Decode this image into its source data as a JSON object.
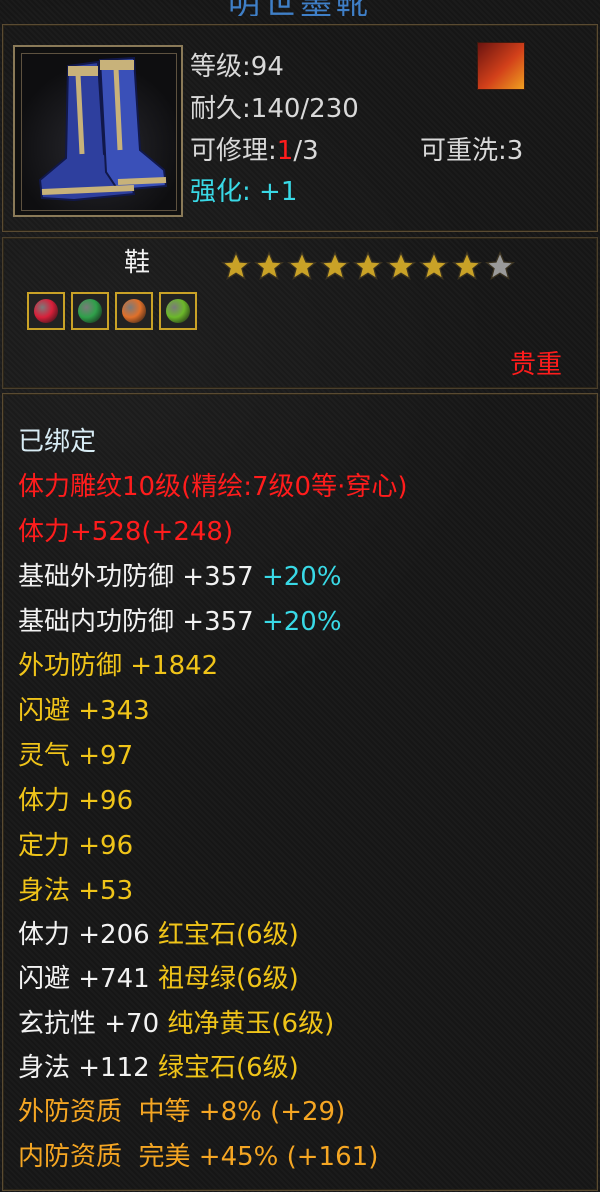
{
  "header": {
    "title": "明世墨靴"
  },
  "item": {
    "level_label": "等级",
    "level_value": ":94",
    "durability_label": "耐久",
    "durability_value": ":140/230",
    "repair_label": "可修理:",
    "repair_used": "1",
    "repair_total": "/3",
    "rewash": "可重洗:3",
    "enhance_label": "强化:",
    "enhance_value": "+1"
  },
  "slot": {
    "type": "鞋",
    "stars_filled": 8,
    "stars_total": 9,
    "rarity": "贵重"
  },
  "gems": [
    {
      "color": "#d8203a"
    },
    {
      "color": "#2fa04a"
    },
    {
      "color": "#e0702a"
    },
    {
      "color": "#6cb82a"
    }
  ],
  "colors": {
    "icon_border": "#8a7a58",
    "gem_border": "#c9a227",
    "star_gold": "#c9a227",
    "star_grey": "#9a9a9a"
  },
  "stats": {
    "bound": "已绑定",
    "engrave": "体力雕纹10级(精绘:7级0等·穿心)",
    "stamina_total": "体力+528(+248)",
    "base_outer_def_label": "基础外功防御",
    "base_outer_def_value": "+357",
    "base_outer_def_pct": "+20%",
    "base_inner_def_label": "基础内功防御",
    "base_inner_def_value": "+357",
    "base_inner_def_pct": "+20%",
    "outer_def": "外功防御 +1842",
    "dodge": "闪避 +343",
    "spirit": "灵气 +97",
    "stamina": "体力 +96",
    "focus": "定力 +96",
    "agility": "身法 +53",
    "gem1_stat": "体力 +206",
    "gem1_name": "红宝石(6级)",
    "gem2_stat": "闪避 +741",
    "gem2_name": "祖母绿(6级)",
    "gem3_stat": "玄抗性 +70",
    "gem3_name": "纯净黄玉(6级)",
    "gem4_stat": "身法 +112",
    "gem4_name": "绿宝石(6级)",
    "outer_quality": "外防资质  中等 +8% (+29)",
    "inner_quality": "内防资质  完美 +45% (+161)"
  }
}
